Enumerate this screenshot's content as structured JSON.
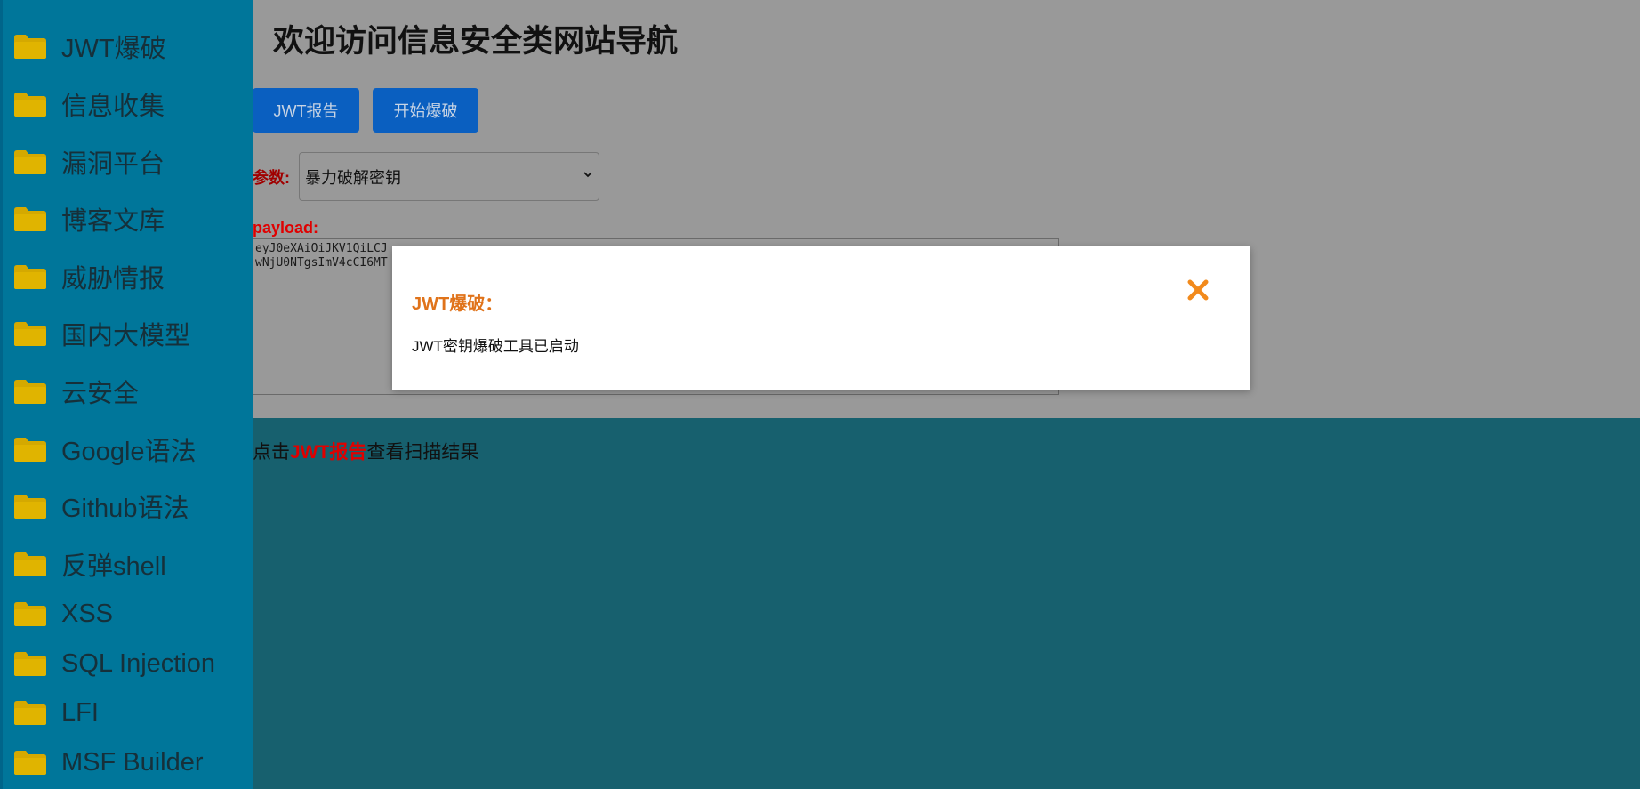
{
  "sidebar": {
    "items": [
      {
        "label": "JWT爆破"
      },
      {
        "label": "信息收集"
      },
      {
        "label": "漏洞平台"
      },
      {
        "label": "博客文库"
      },
      {
        "label": "威胁情报"
      },
      {
        "label": "国内大模型"
      },
      {
        "label": "云安全"
      },
      {
        "label": "Google语法"
      },
      {
        "label": "Github语法"
      },
      {
        "label": "反弹shell"
      },
      {
        "label": "XSS"
      },
      {
        "label": "SQL Injection"
      },
      {
        "label": "LFI"
      },
      {
        "label": "MSF Builder"
      }
    ],
    "icon": "folder-icon"
  },
  "main": {
    "title": "欢迎访问信息安全类网站导航",
    "buttons": {
      "report": "JWT报告",
      "start": "开始爆破"
    },
    "param_label": "参数:",
    "param_selected": "暴力破解密钥",
    "payload_label": "payload:",
    "payload_line1": "eyJ0eXAiOiJKV1QiLCJ",
    "payload_line2": "wNjU0NTgsImV4cCI6MT",
    "hint_prefix": "点击",
    "hint_link": "JWT报告",
    "hint_suffix": "查看扫描结果"
  },
  "modal": {
    "title": "JWT爆破：",
    "message": "JWT密钥爆破工具已启动",
    "close_icon": "close-icon"
  },
  "colors": {
    "sidebar_bg": "#00769a",
    "folder": "#d4a900",
    "backdrop": "#999999",
    "lower_bg": "#17606e",
    "button": "#0a5fc0",
    "modal_accent": "#e0731a",
    "danger": "#e00000"
  }
}
